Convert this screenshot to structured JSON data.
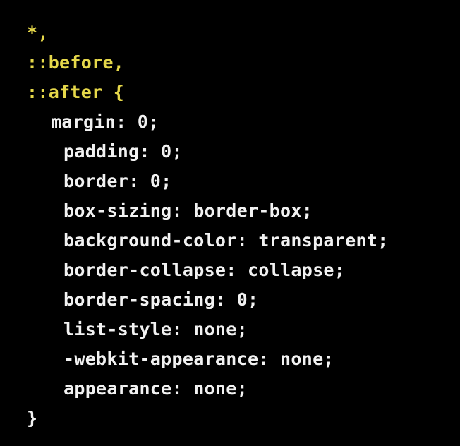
{
  "lines": [
    {
      "text": "*,",
      "kind": "selector"
    },
    {
      "text": "::before,",
      "kind": "selector"
    },
    {
      "text": "::after {",
      "kind": "selector-open"
    },
    {
      "text": "margin: 0;",
      "kind": "declaration"
    },
    {
      "text": "padding: 0;",
      "kind": "declaration"
    },
    {
      "text": "border: 0;",
      "kind": "declaration"
    },
    {
      "text": "box-sizing: border-box;",
      "kind": "declaration"
    },
    {
      "text": "background-color: transparent;",
      "kind": "declaration"
    },
    {
      "text": "border-collapse: collapse;",
      "kind": "declaration"
    },
    {
      "text": "border-spacing: 0;",
      "kind": "declaration"
    },
    {
      "text": "list-style: none;",
      "kind": "declaration"
    },
    {
      "text": "-webkit-appearance: none;",
      "kind": "declaration"
    },
    {
      "text": "appearance: none;",
      "kind": "declaration"
    },
    {
      "text": "}",
      "kind": "close"
    }
  ],
  "colors": {
    "background": "#000000",
    "selector": "#e6d84a",
    "text": "#f2f2f2"
  }
}
